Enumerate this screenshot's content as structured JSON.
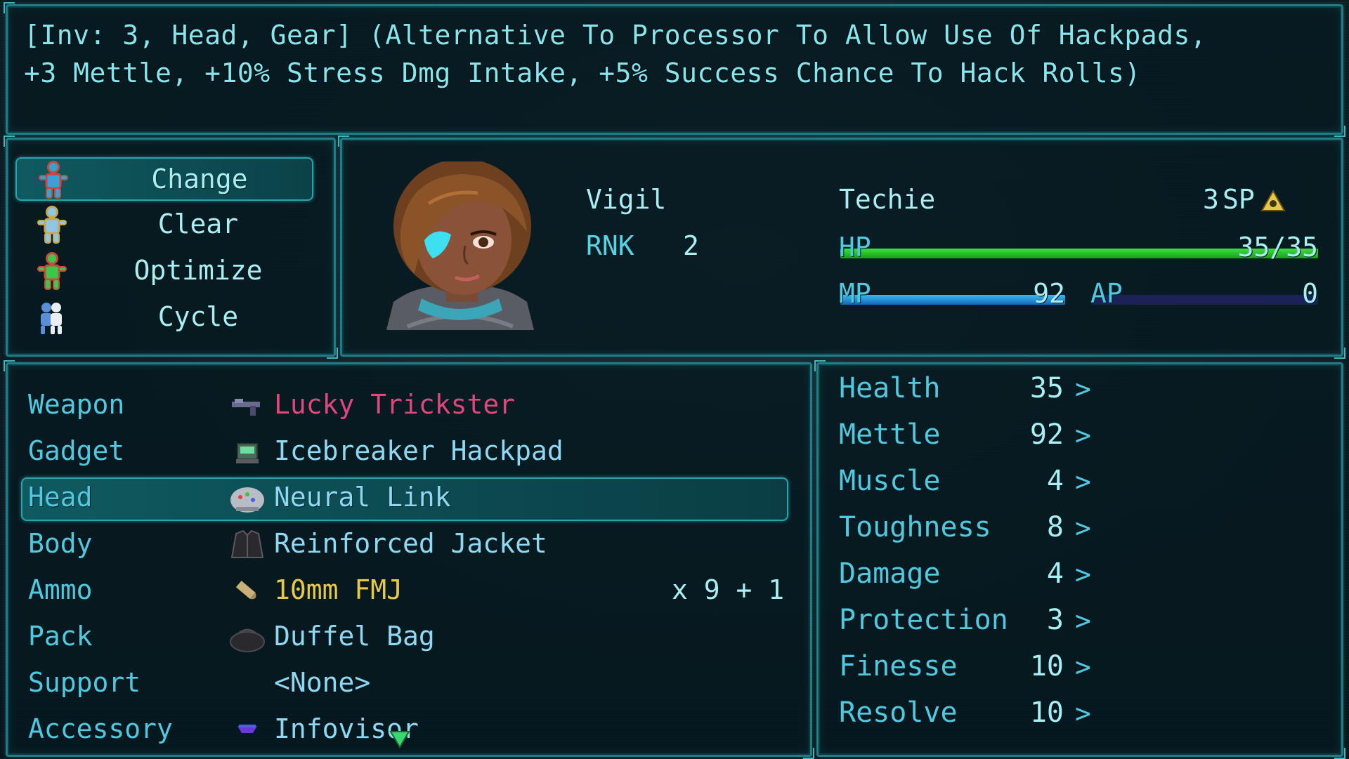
{
  "help": {
    "line1": "[Inv: 3, Head, Gear] (Alternative To Processor To Allow Use Of Hackpads,",
    "line2": "+3 Mettle, +10% Stress Dmg Intake, +5% Success Chance To Hack Rolls)"
  },
  "commands": [
    {
      "label": "Change",
      "icon": "figure-change-icon"
    },
    {
      "label": "Clear",
      "icon": "figure-clear-icon"
    },
    {
      "label": "Optimize",
      "icon": "figure-optimize-icon"
    },
    {
      "label": "Cycle",
      "icon": "figure-cycle-icon"
    }
  ],
  "actor": {
    "name": "Vigil",
    "rank_label": "RNK",
    "rank": "2",
    "class": "Techie",
    "sp": "3",
    "sp_label": "SP",
    "hp_label": "HP",
    "hp_text": "35/35",
    "hp_fraction": 1.0,
    "mp_label": "MP",
    "mp_text": "92",
    "mp_fraction": 1.0,
    "ap_label": "AP",
    "ap_text": "0",
    "ap_fraction": 0.0
  },
  "equipment": [
    {
      "slot": "Weapon",
      "item": "Lucky Trickster",
      "color": "#e0457c",
      "icon": "gun-icon"
    },
    {
      "slot": "Gadget",
      "item": "Icebreaker Hackpad",
      "color": "#8fd8f3",
      "icon": "hackpad-icon"
    },
    {
      "slot": "Head",
      "item": "Neural Link",
      "color": "#8fd8f3",
      "icon": "neural-helmet-icon"
    },
    {
      "slot": "Body",
      "item": "Reinforced Jacket",
      "color": "#8fd8f3",
      "icon": "jacket-icon"
    },
    {
      "slot": "Ammo",
      "item": "10mm FMJ",
      "color": "#e8c84a",
      "icon": "bullet-icon",
      "count": "x 9 + 1"
    },
    {
      "slot": "Pack",
      "item": "Duffel Bag",
      "color": "#8fd8f3",
      "icon": "bag-icon"
    },
    {
      "slot": "Support",
      "item": "<None>",
      "color": "#8fd8f3",
      "icon": ""
    },
    {
      "slot": "Accessory",
      "item": "Infovisor",
      "color": "#8fd8f3",
      "icon": "visor-icon"
    }
  ],
  "stats": [
    {
      "name": "Health",
      "value": "35"
    },
    {
      "name": "Mettle",
      "value": "92"
    },
    {
      "name": "Muscle",
      "value": "4"
    },
    {
      "name": "Toughness",
      "value": "8"
    },
    {
      "name": "Damage",
      "value": "4"
    },
    {
      "name": "Protection",
      "value": "3"
    },
    {
      "name": "Finesse",
      "value": "10"
    },
    {
      "name": "Resolve",
      "value": "10"
    }
  ],
  "stat_arrow": ">",
  "colors": {
    "hp_gauge": "#1fc41f",
    "mp_gauge": "#1a8fdc",
    "ap_gauge": "#1f2a6a",
    "border": "#1f7d86"
  }
}
